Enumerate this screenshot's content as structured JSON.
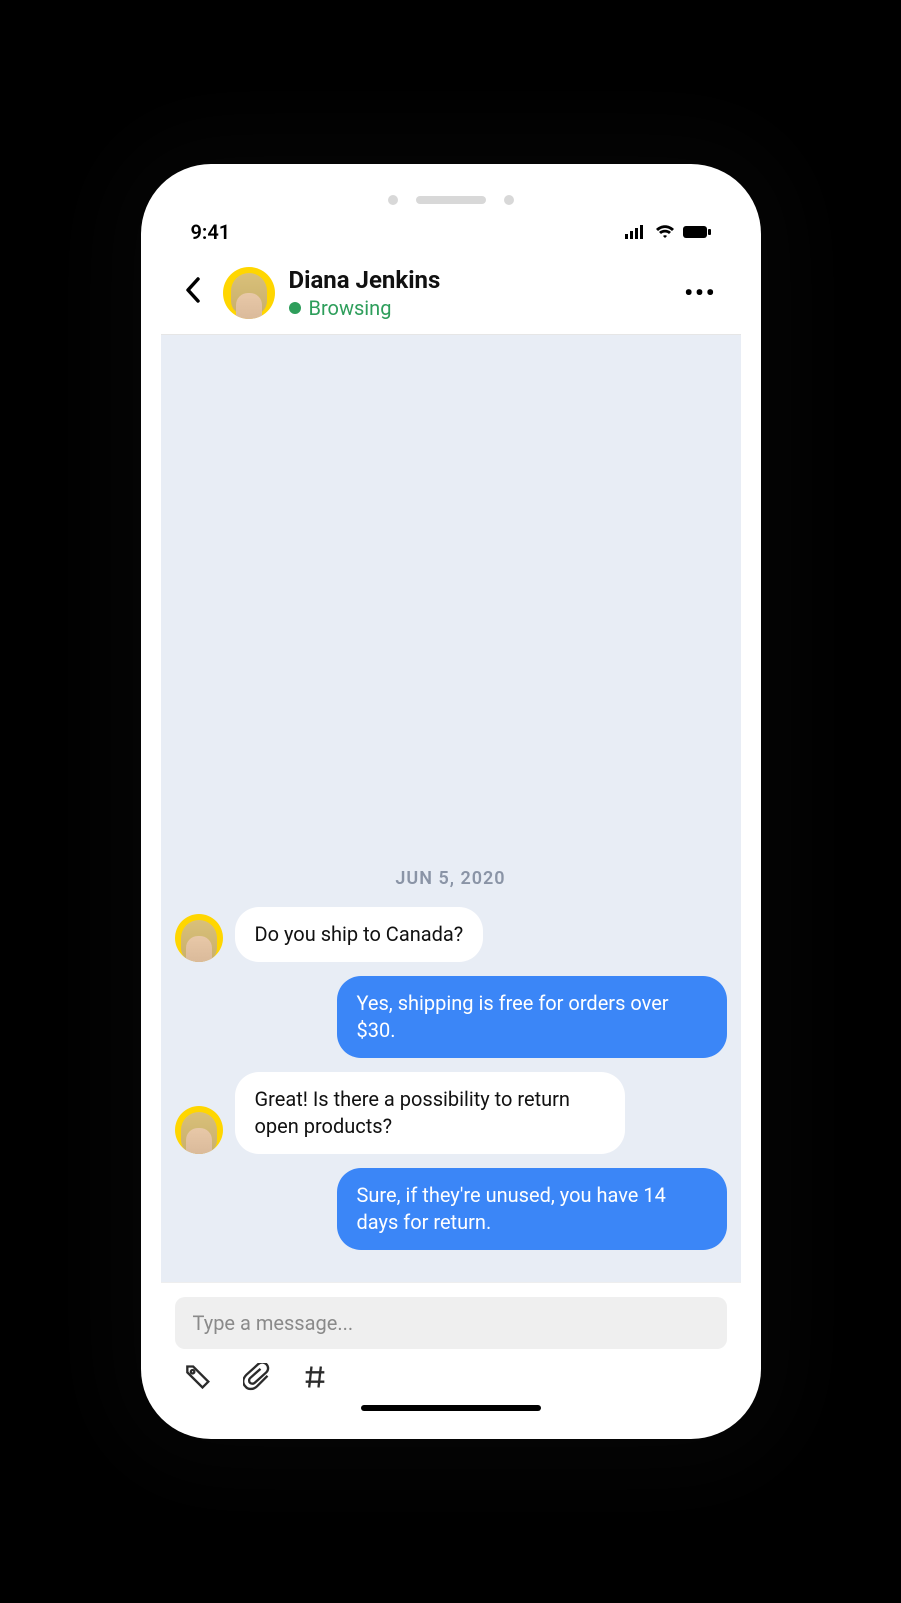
{
  "status_bar": {
    "time": "9:41"
  },
  "header": {
    "name": "Diana Jenkins",
    "status": "Browsing"
  },
  "chat": {
    "date": "JUN 5, 2020",
    "messages": [
      {
        "side": "in",
        "text": "Do you ship to Canada?"
      },
      {
        "side": "out",
        "text": "Yes, shipping is free for orders over $30."
      },
      {
        "side": "in",
        "text": "Great! Is there a possibility to return open products?"
      },
      {
        "side": "out",
        "text": "Sure, if they're unused, you have 14 days for return."
      }
    ]
  },
  "composer": {
    "placeholder": "Type a message..."
  }
}
